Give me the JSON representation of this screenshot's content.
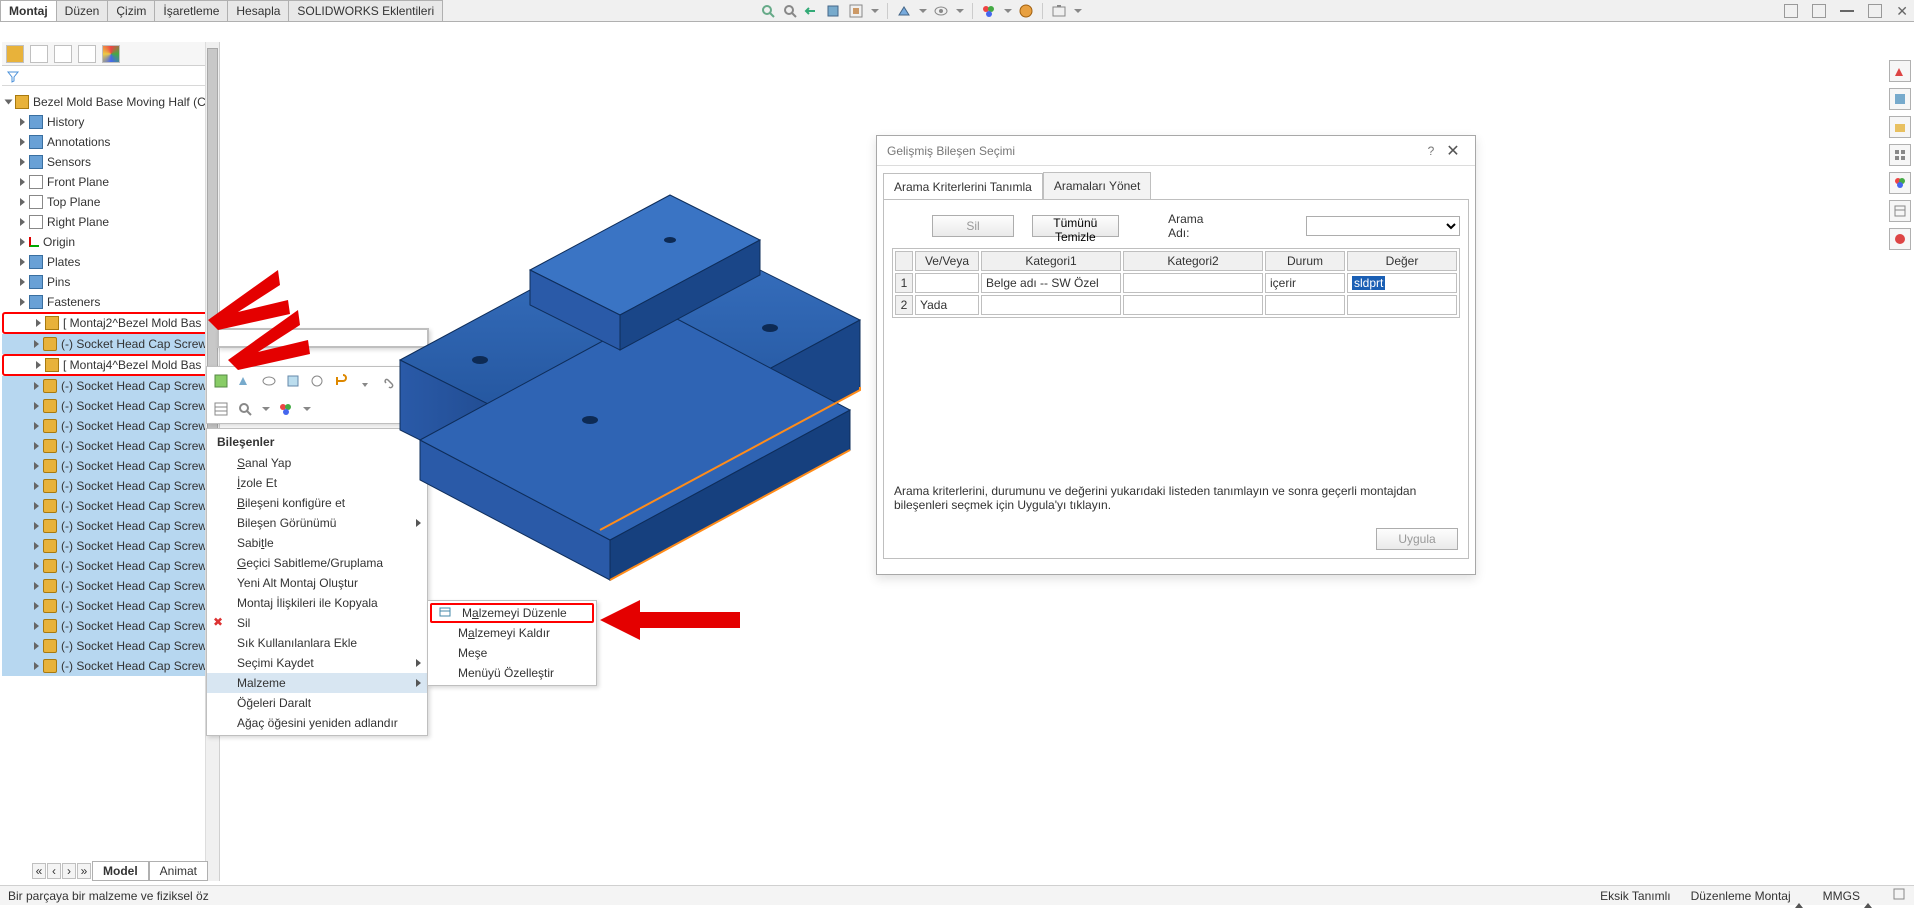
{
  "cmd_tabs": [
    "Montaj",
    "Düzen",
    "Çizim",
    "İşaretleme",
    "Hesapla",
    "SOLIDWORKS Eklentileri"
  ],
  "active_cmd_tab": 0,
  "hud_icons": [
    "zoom-fit",
    "zoom-area",
    "prev-view",
    "section-view",
    "view-settings",
    "display-style",
    "hide-show",
    "appearance",
    "scene",
    "screen-capture"
  ],
  "taskpane_tabs": [
    "solidworks-resources",
    "design-library",
    "file-explorer",
    "view-palette",
    "appearances",
    "custom-props",
    "forum"
  ],
  "feature_tree": {
    "root": "Bezel Mold Base Moving Half  (C[",
    "items": [
      {
        "icon": "folder",
        "label": "History"
      },
      {
        "icon": "folder",
        "label": "Annotations"
      },
      {
        "icon": "folder",
        "label": "Sensors"
      },
      {
        "icon": "plane",
        "label": "Front Plane"
      },
      {
        "icon": "plane",
        "label": "Top Plane"
      },
      {
        "icon": "plane",
        "label": "Right Plane"
      },
      {
        "icon": "origin",
        "label": "Origin"
      },
      {
        "icon": "folder",
        "label": "Plates"
      },
      {
        "icon": "folder",
        "label": "Pins"
      },
      {
        "icon": "folder",
        "label": "Fasteners",
        "open": true
      },
      {
        "icon": "asm",
        "label": "[ Montaj2^Bezel Mold Bas",
        "callout": true,
        "indent": 2
      },
      {
        "icon": "part",
        "label": "(-) Socket Head Cap Screw",
        "indent": 2,
        "sel": true
      },
      {
        "icon": "asm",
        "label": "[ Montaj4^Bezel Mold Bas",
        "callout": true,
        "indent": 2
      },
      {
        "icon": "part",
        "label": "(-) Socket Head Cap Screw",
        "indent": 2,
        "sel": true
      },
      {
        "icon": "part",
        "label": "(-) Socket Head Cap Screw",
        "indent": 2,
        "sel": true
      },
      {
        "icon": "part",
        "label": "(-) Socket Head Cap Screw",
        "indent": 2,
        "sel": true
      },
      {
        "icon": "part",
        "label": "(-) Socket Head Cap Screw",
        "indent": 2,
        "sel": true
      },
      {
        "icon": "part",
        "label": "(-) Socket Head Cap Screw",
        "indent": 2,
        "sel": true
      },
      {
        "icon": "part",
        "label": "(-) Socket Head Cap Screw",
        "indent": 2,
        "sel": true
      },
      {
        "icon": "part",
        "label": "(-) Socket Head Cap Screw",
        "indent": 2,
        "sel": true
      },
      {
        "icon": "part",
        "label": "(-) Socket Head Cap Screw",
        "indent": 2,
        "sel": true
      },
      {
        "icon": "part",
        "label": "(-) Socket Head Cap Screw",
        "indent": 2,
        "sel": true
      },
      {
        "icon": "part",
        "label": "(-) Socket Head Cap Screw",
        "indent": 2,
        "sel": true
      },
      {
        "icon": "part",
        "label": "(-) Socket Head Cap Screw",
        "indent": 2,
        "sel": true
      },
      {
        "icon": "part",
        "label": "(-) Socket Head Cap Screw",
        "indent": 2,
        "sel": true
      },
      {
        "icon": "part",
        "label": "(-) Socket Head Cap Screw",
        "indent": 2,
        "sel": true
      },
      {
        "icon": "part",
        "label": "(-) Socket Head Cap Screw",
        "indent": 2,
        "sel": true
      },
      {
        "icon": "part",
        "label": "(-) Socket Head Cap Screw",
        "indent": 2,
        "sel": true
      }
    ]
  },
  "bottom_tabs": [
    "Model",
    "Animat"
  ],
  "context": {
    "header": "Bileşenler",
    "items": [
      {
        "label": "Sanal Yap",
        "u": 0
      },
      {
        "label": "İzole Et",
        "u": 0
      },
      {
        "label": "Bileşeni konfigüre et",
        "u": 0
      },
      {
        "label": "Bileşen Görünümü",
        "sub": true
      },
      {
        "label": "Sabitle",
        "u": 4
      },
      {
        "label": "Geçici Sabitleme/Gruplama",
        "u": 0
      },
      {
        "label": "Yeni Alt Montaj Oluştur"
      },
      {
        "label": "Montaj İlişkileri ile Kopyala"
      },
      {
        "label": "Sil"
      },
      {
        "label": "Sık Kullanılanlara Ekle"
      },
      {
        "label": "Seçimi Kaydet",
        "sub": true
      },
      {
        "label": "Malzeme",
        "sub": true
      },
      {
        "label": "Öğeleri Daralt"
      },
      {
        "label": "Ağaç öğesini yeniden adlandır"
      }
    ],
    "highlight_index": 11,
    "sub": [
      {
        "label": "Malzemeyi Düzenle",
        "boxed": true
      },
      {
        "label": "Malzemeyi Kaldır"
      },
      {
        "label": "Meşe"
      },
      {
        "label": "Menüyü Özelleştir"
      }
    ]
  },
  "dialog": {
    "title": "Gelişmiş Bileşen Seçimi",
    "tabs": [
      "Arama Kriterlerini Tanımla",
      "Aramaları Yönet"
    ],
    "active_tab": 0,
    "buttons": {
      "delete": "Sil",
      "clear": "Tümünü Temizle",
      "apply": "Uygula"
    },
    "search_name_label": "Arama Adı:",
    "columns": [
      "",
      "Ve/Veya",
      "Kategori1",
      "Kategori2",
      "Durum",
      "Değer"
    ],
    "rows": [
      {
        "n": "1",
        "andor": "",
        "cat1": "Belge adı -- SW Özel",
        "cat2": "",
        "cond": "içerir",
        "val": "sldprt",
        "val_sel": true
      },
      {
        "n": "2",
        "andor": "Yada",
        "cat1": "",
        "cat2": "",
        "cond": "",
        "val": ""
      }
    ],
    "help_text": "Arama kriterlerini, durumunu ve değerini yukarıdaki listeden tanımlayın ve sonra geçerli montajdan bileşenleri seçmek için Uygula'yı tıklayın."
  },
  "status_bar": {
    "left": "Bir parçaya bir malzeme ve fiziksel öz",
    "segments": [
      "Eksik Tanımlı",
      "Düzenleme Montaj",
      "MMGS"
    ]
  }
}
